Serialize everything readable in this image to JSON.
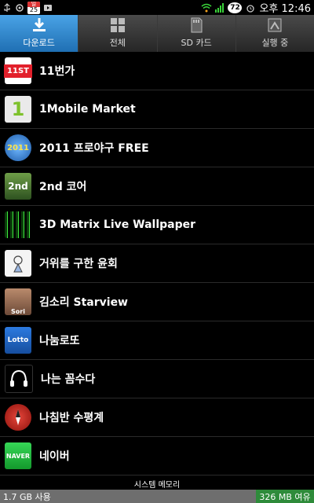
{
  "status_bar": {
    "calendar_month": "일",
    "calendar_day": "25",
    "battery_level": "72",
    "time": "오후 12:46"
  },
  "tabs": [
    {
      "label": "다운로드",
      "icon": "download-icon",
      "active": true
    },
    {
      "label": "전체",
      "icon": "grid-icon",
      "active": false
    },
    {
      "label": "SD 카드",
      "icon": "sdcard-icon",
      "active": false
    },
    {
      "label": "실행 중",
      "icon": "running-icon",
      "active": false
    }
  ],
  "apps": [
    {
      "name": "11번가",
      "icon": "11st-icon",
      "icon_text": "11ST",
      "color": "#e2202b"
    },
    {
      "name": "1Mobile Market",
      "icon": "1mobile-icon",
      "icon_text": "1",
      "color": "#7ec12b"
    },
    {
      "name": "2011 프로야구 FREE",
      "icon": "baseball-icon",
      "icon_text": "2011",
      "color": "#2a74c7"
    },
    {
      "name": "2nd 코어",
      "icon": "2nd-core-icon",
      "icon_text": "2nd",
      "color": "#4b7d2f"
    },
    {
      "name": "3D Matrix Live Wallpaper",
      "icon": "matrix-icon",
      "icon_text": "",
      "color": "#0b3d0b"
    },
    {
      "name": "거위를 구한 윤회",
      "icon": "goose-icon",
      "icon_text": "",
      "color": "#f2f2f2"
    },
    {
      "name": "김소리 Starview",
      "icon": "starview-icon",
      "icon_text": "Sori",
      "color": "#c89a7a"
    },
    {
      "name": "나눔로또",
      "icon": "lotto-icon",
      "icon_text": "Lotto",
      "color": "#1e63c8"
    },
    {
      "name": "나는 꼼수다",
      "icon": "podcast-icon",
      "icon_text": "",
      "color": "#111"
    },
    {
      "name": "나침반 수평계",
      "icon": "compass-icon",
      "icon_text": "",
      "color": "#c0271d"
    },
    {
      "name": "네이버",
      "icon": "naver-icon",
      "icon_text": "NAVER",
      "color": "#1fbf3b"
    }
  ],
  "memory": {
    "label": "시스템 메모리",
    "used": "1.7 GB 사용",
    "free": "326 MB 여유"
  }
}
